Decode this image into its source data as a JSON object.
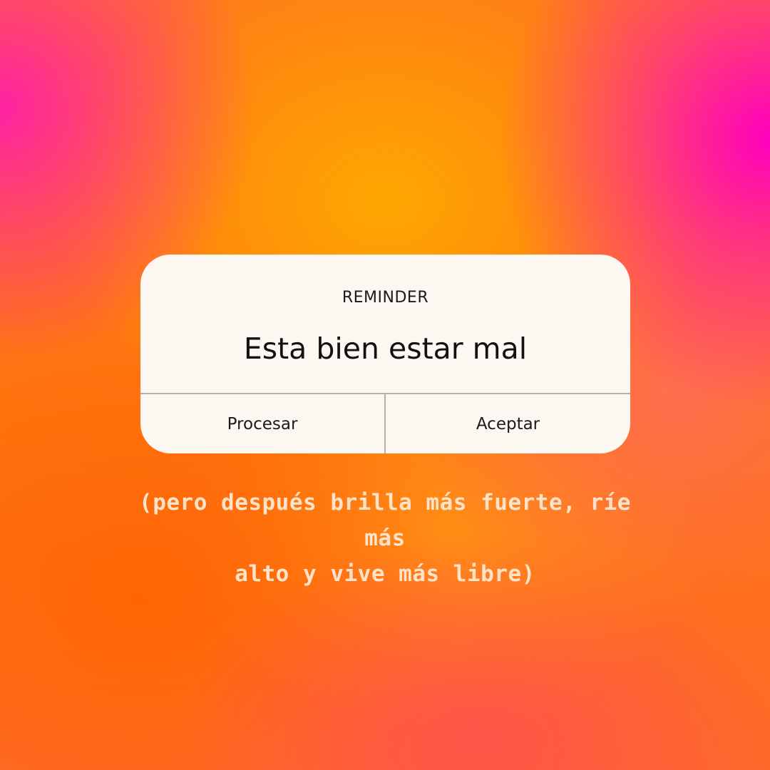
{
  "dialog": {
    "label": "REMINDER",
    "message": "Esta bien estar mal",
    "buttons": {
      "left": "Procesar",
      "right": "Aceptar"
    },
    "background_color": "#fdf7f1"
  },
  "caption": {
    "line1": "(pero después brilla más fuerte, ríe más",
    "line2": "alto y vive más libre)"
  },
  "colors": {
    "background_primary": "#ff8c14",
    "background_accent_pink": "#ff1eaa",
    "caption_text": "#ffe3c8"
  }
}
